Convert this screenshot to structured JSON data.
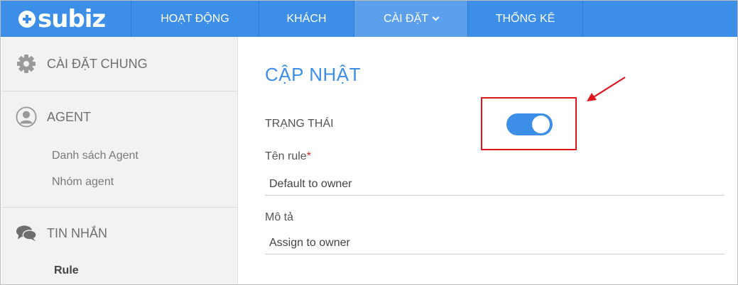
{
  "brand": {
    "name": "subiz"
  },
  "nav": {
    "items": [
      {
        "label": "HOẠT ĐỘNG"
      },
      {
        "label": "KHÁCH"
      },
      {
        "label": "CÀI ĐẶT"
      },
      {
        "label": "THỐNG KÊ"
      }
    ]
  },
  "sidebar": {
    "general": {
      "label": "CÀI ĐẶT CHUNG",
      "icon": "gear-icon"
    },
    "agent": {
      "label": "AGENT",
      "icon": "user-circle-icon",
      "items": [
        {
          "label": "Danh sách Agent"
        },
        {
          "label": "Nhóm agent"
        }
      ]
    },
    "messages": {
      "label": "TIN NHẮN",
      "icon": "chat-bubbles-icon",
      "items": [
        {
          "label": "Rule"
        }
      ]
    }
  },
  "main": {
    "title": "CẬP NHẬT",
    "status_label": "TRẠNG THÁI",
    "status_on": true,
    "rule_name": {
      "label": "Tên rule",
      "required_mark": "*",
      "value": "Default to owner"
    },
    "description": {
      "label": "Mô tả",
      "value": "Assign to owner"
    }
  },
  "colors": {
    "accent": "#3d8ee6",
    "annotation": "#e0141c"
  }
}
